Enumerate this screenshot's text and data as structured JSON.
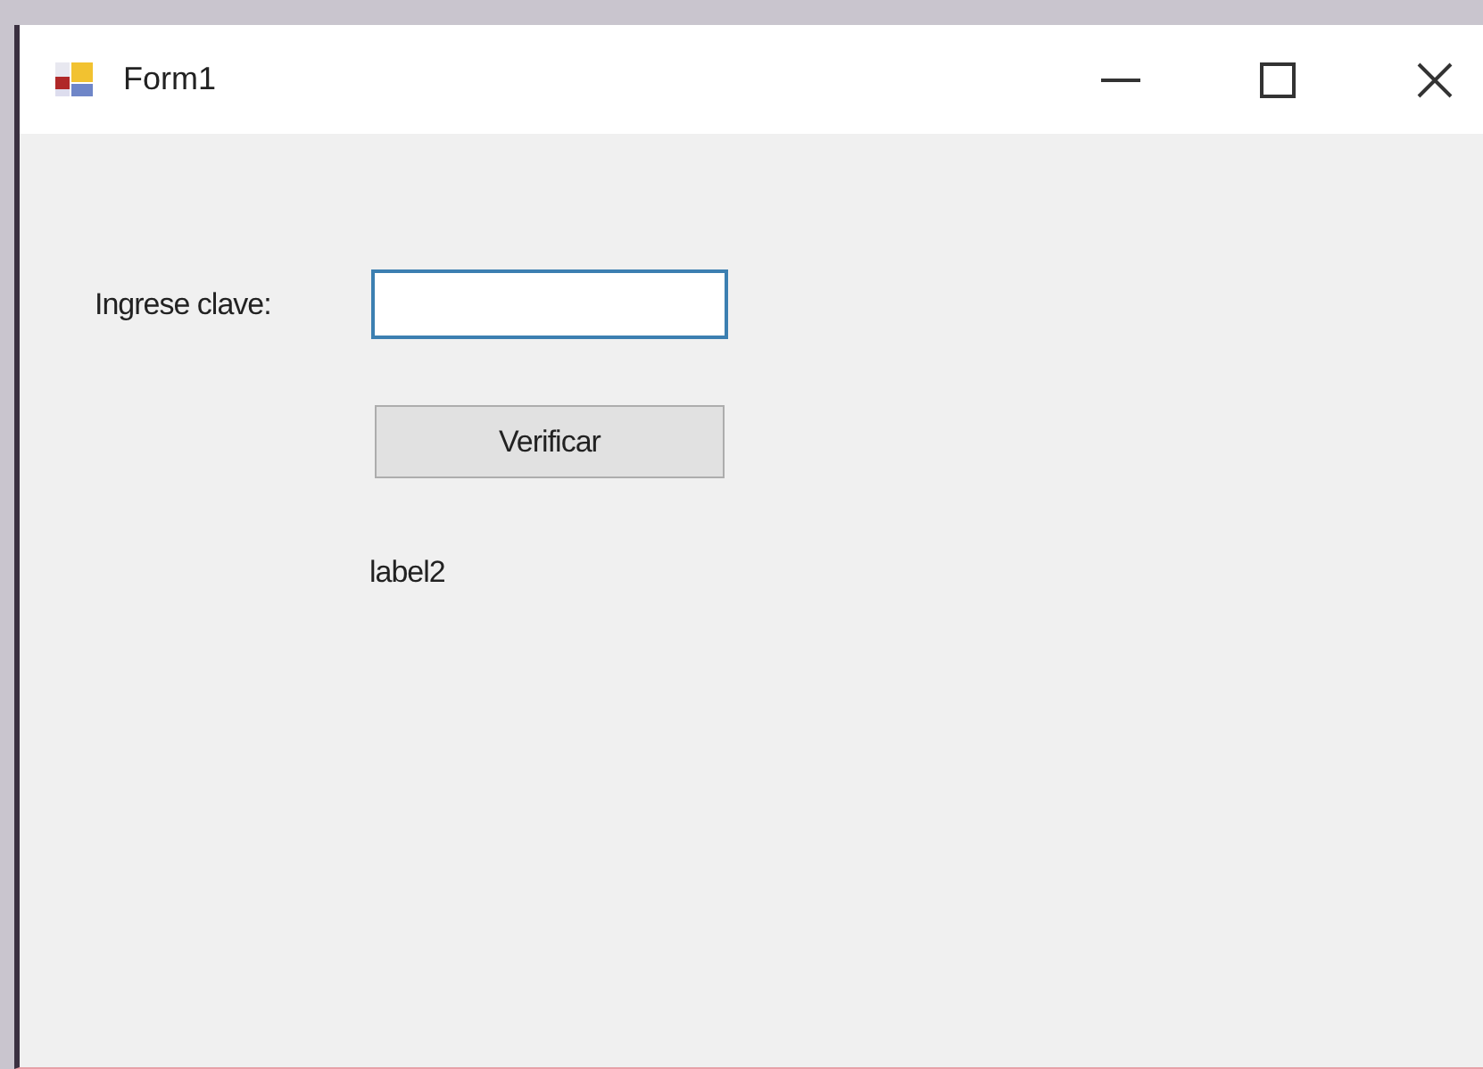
{
  "window": {
    "title": "Form1"
  },
  "form": {
    "label": "Ingrese clave:",
    "button": "Verificar",
    "status_label": "label2"
  }
}
